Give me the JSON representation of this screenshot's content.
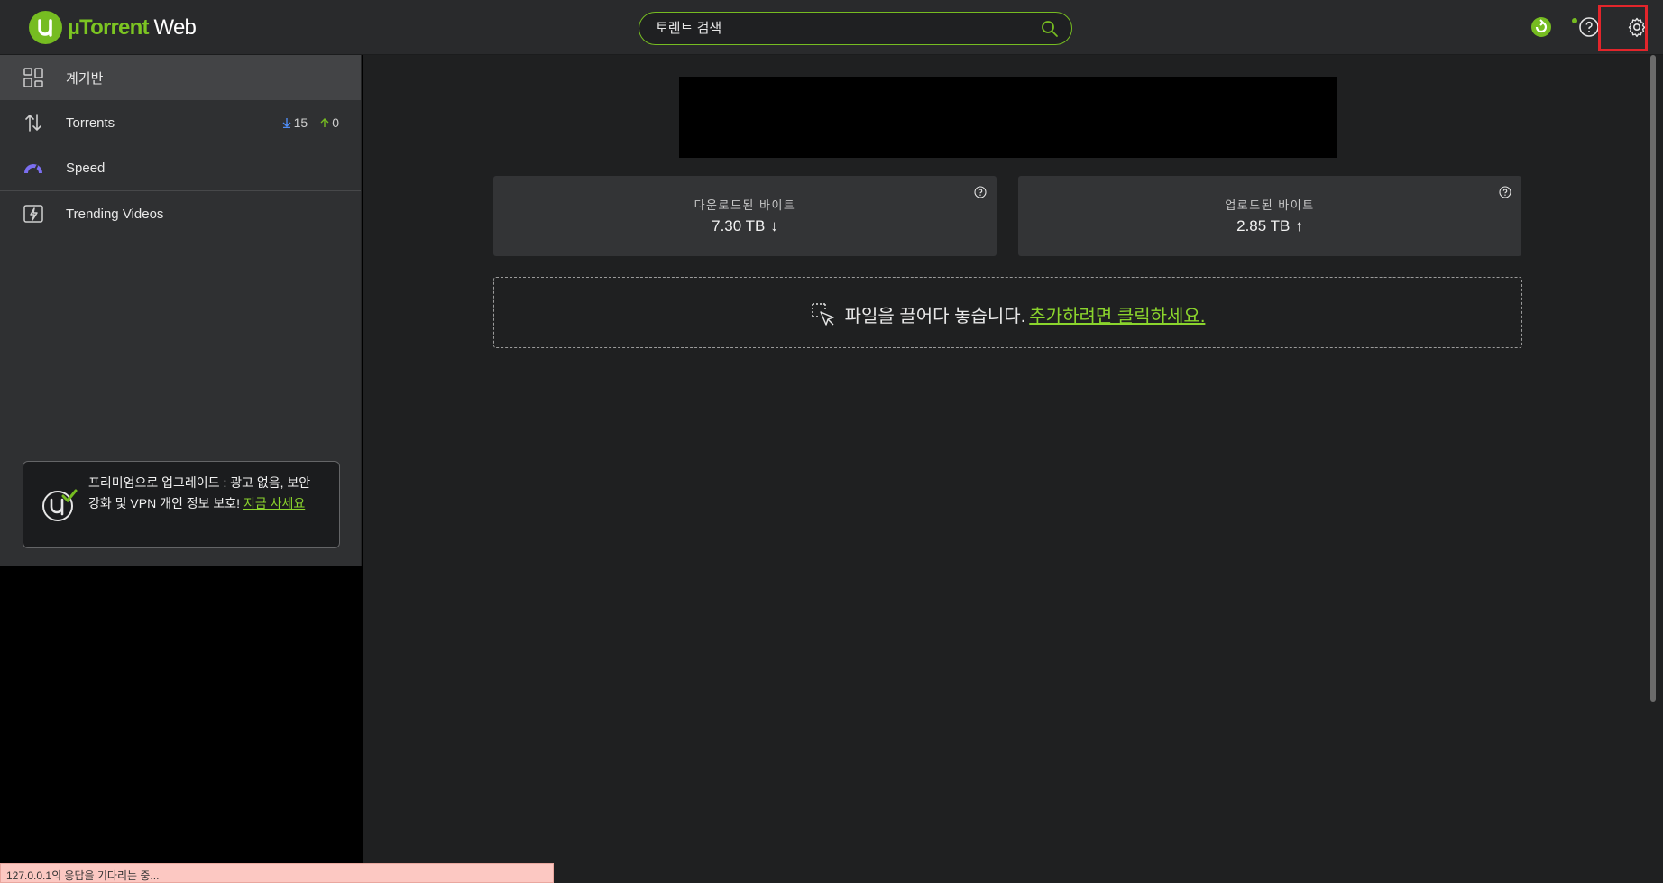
{
  "header": {
    "brand": "µTorrent",
    "brand_suffix": " Web",
    "search_placeholder": "토렌트 검색",
    "icons": [
      "remote-access-icon",
      "help-icon",
      "settings-icon"
    ],
    "accent_color": "#76bc21",
    "highlight_color": "#e2252b"
  },
  "sidebar": {
    "items": [
      {
        "label": "계기반",
        "icon": "dashboard-icon"
      },
      {
        "label": "Torrents",
        "icon": "torrents-icon",
        "download_count": "15",
        "upload_count": "0"
      },
      {
        "label": "Speed",
        "icon": "speed-icon"
      },
      {
        "label": "Trending Videos",
        "icon": "trending-videos-icon"
      }
    ],
    "promo": {
      "text": "프리미엄으로 업그레이드 : 광고 없음, 보안 강화 및 VPN 개인 정보 보호! ",
      "link": "지금 사세요"
    }
  },
  "main": {
    "downloaded": {
      "label": "다운로드된 바이트",
      "value": "7.30 TB",
      "arrow": "↓"
    },
    "uploaded": {
      "label": "업로드된 바이트",
      "value": "2.85 TB",
      "arrow": "↑"
    },
    "dropzone": {
      "text": "파일을 끌어다 놓습니다.",
      "link": "추가하려면 클릭하세요."
    }
  },
  "statusbar": {
    "text": "127.0.0.1의 응답을 기다리는 중..."
  }
}
